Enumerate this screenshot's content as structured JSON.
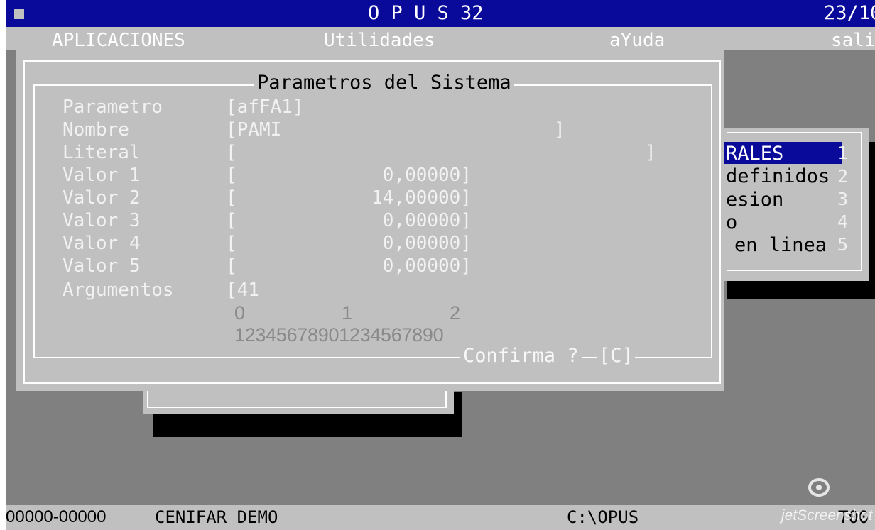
{
  "titlebar": {
    "title": "O P U S 32",
    "date": "23/10/"
  },
  "menubar": {
    "aplicaciones": "APLICACIONES",
    "utilidades": "Utilidades",
    "ayuda": "aYuda",
    "salir": "sali"
  },
  "submenu": {
    "items": [
      {
        "label": "RALES",
        "hotkey": "1"
      },
      {
        "label": "definidos",
        "hotkey": "2"
      },
      {
        "label": "esion",
        "hotkey": "3"
      },
      {
        "label": "o",
        "hotkey": "4"
      },
      {
        "label": "en linea",
        "hotkey": "5"
      }
    ]
  },
  "dialog": {
    "title": "Parametros del Sistema",
    "fields": [
      {
        "label": "Parametro",
        "value": "[afFA1]"
      },
      {
        "label": "Nombre",
        "value": "[PAMI",
        "close": "]"
      },
      {
        "label": "Literal",
        "value": "[",
        "close": "]"
      }
    ],
    "valores": [
      {
        "label": "Valor 1",
        "value": "0,00000]"
      },
      {
        "label": "Valor 2",
        "value": "14,00000]"
      },
      {
        "label": "Valor 3",
        "value": "0,00000]"
      },
      {
        "label": "Valor 4",
        "value": "0,00000]"
      },
      {
        "label": "Valor 5",
        "value": "0,00000]"
      }
    ],
    "argumentos": {
      "label": "Argumentos",
      "value": "[41"
    },
    "ruler": {
      "tens": [
        "0",
        "1",
        "2"
      ],
      "digits": "12345678901234567890"
    },
    "confirm": {
      "label": "Confirma ?",
      "value": "[C]"
    }
  },
  "statusbar": {
    "code": "00000-00000",
    "company": "CENIFAR DEMO",
    "path": "C:\\OPUS",
    "right": "T00"
  },
  "watermark": {
    "text": "jetScreenshot"
  },
  "colors": {
    "desktop": "#808080",
    "titlebar": "#0a0a9a",
    "panel": "#c0c0c0",
    "highlight": "#0a0a9a"
  }
}
